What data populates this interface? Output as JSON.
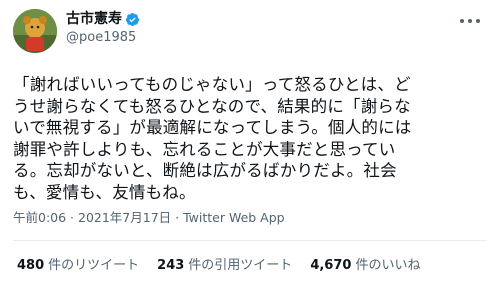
{
  "author": {
    "display_name": "古市憲寿",
    "handle": "@poe1985"
  },
  "tweet": {
    "lines": [
      "「謝ればいいってものじゃない」って怒るひとは、ど",
      "うせ謝らなくても怒るひとなので、結果的に「謝らな",
      "いで無視する」が最適解になってしまう。個人的には",
      "謝罪や許しよりも、忘れることが大事だと思ってい",
      "る。忘却がないと、断絶は広がるばかりだよ。社会",
      "も、愛情も、友情もね。"
    ]
  },
  "meta": {
    "time": "午前0:06",
    "date": "2021年7月17日",
    "source": "Twitter Web App",
    "separator": " · "
  },
  "stats": {
    "retweets_count": "480",
    "retweets_label": "件のリツイート",
    "quotes_count": "243",
    "quotes_label": "件の引用ツイート",
    "likes_count": "4,670",
    "likes_label": "件のいいね"
  },
  "colors": {
    "verified": "#1d9bf0",
    "secondary_text": "#536471"
  },
  "icons": {
    "verified": "verified-badge-icon",
    "more": "more-options-icon"
  }
}
